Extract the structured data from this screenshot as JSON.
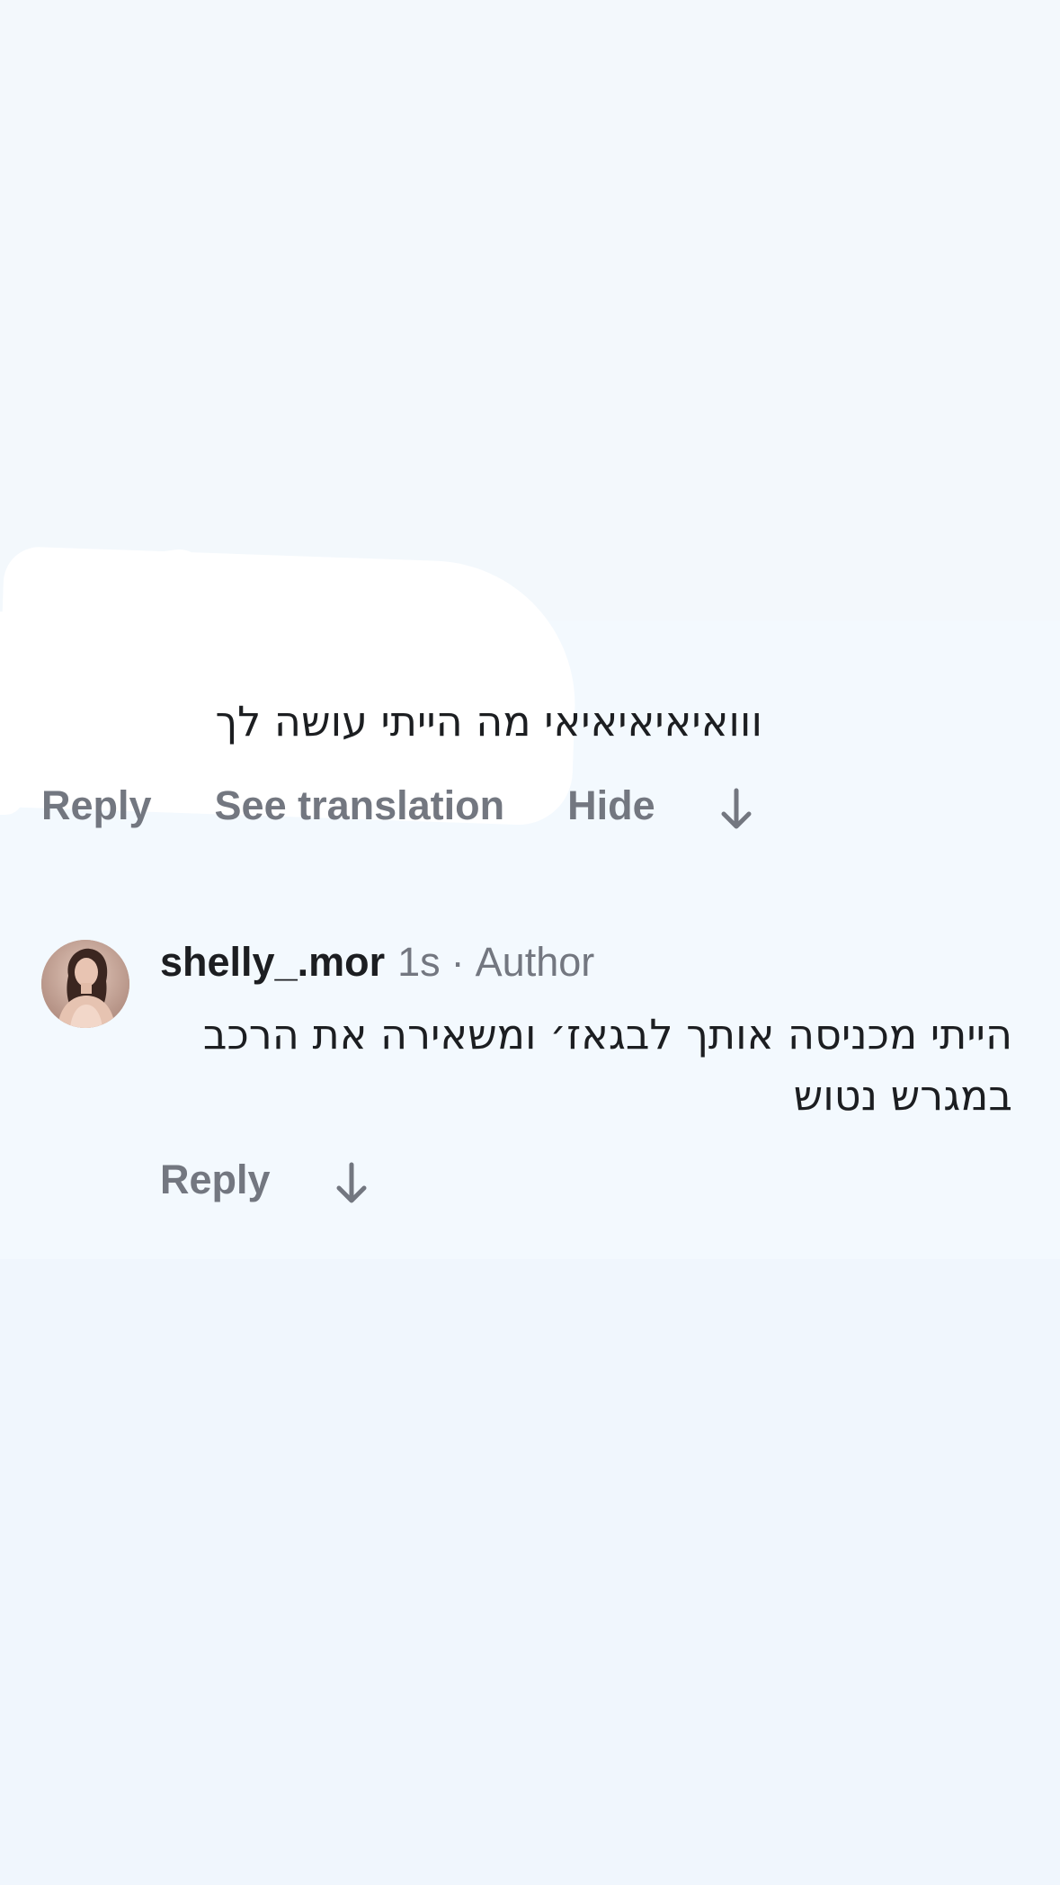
{
  "comments": [
    {
      "text": "ווואיאיאיאיאי מה הייתי עושה לך",
      "actions": {
        "reply": "Reply",
        "see_translation": "See translation",
        "hide": "Hide"
      },
      "icons": {
        "down": "arrow-down-icon"
      }
    },
    {
      "username": "shelly_.mor",
      "time": "1s",
      "separator": "·",
      "role": "Author",
      "text": "הייתי מכניסה אותך לבגאז׳ ומשאירה את הרכב במגרש נטוש",
      "actions": {
        "reply": "Reply"
      },
      "icons": {
        "avatar": "profile-photo",
        "down": "arrow-down-icon"
      }
    }
  ],
  "colors": {
    "background": "#f2f7fc",
    "text": "#1c1e21",
    "muted": "#737780",
    "redaction": "#ffffff"
  }
}
